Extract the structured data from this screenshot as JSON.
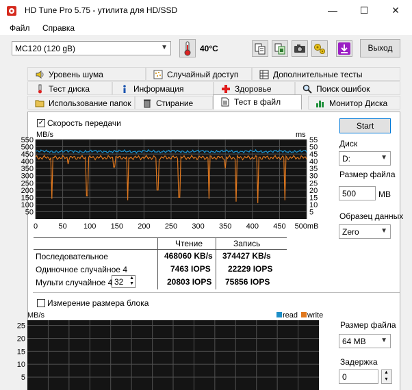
{
  "window": {
    "title": "HD Tune Pro 5.75 - утилита для HD/SSD",
    "minimize": "—",
    "maximize": "☐",
    "close": "✕"
  },
  "menu": {
    "file": "Файл",
    "help": "Справка"
  },
  "toolbar": {
    "drive": "MC120 (120 gB)",
    "temperature": "40°C",
    "exit_label": "Выход"
  },
  "tabs": {
    "row1": [
      "Уровень шума",
      "Случайный доступ",
      "Дополнительные тесты"
    ],
    "row2": [
      "Тест диска",
      "Информация",
      "Здоровье",
      "Поиск ошибок"
    ],
    "row3": [
      "Использование папок",
      "Стирание",
      "Тест в файл",
      "Монитор Диска"
    ]
  },
  "transfer": {
    "checkbox_label": "Скорость передачи",
    "left_unit": "MB/s",
    "right_unit": "ms",
    "x_unit_suffix": "mB"
  },
  "results": {
    "col_read": "Чтение",
    "col_write": "Запись",
    "rows": [
      {
        "label": "Последовательное",
        "read": "468060 KB/s",
        "write": "374427 KB/s"
      },
      {
        "label": "Одиночное случайное 4",
        "read": "7463 IOPS",
        "write": "22229 IOPS"
      },
      {
        "label": "Мульти случайное 4",
        "read": "20803 IOPS",
        "write": "75856 IOPS"
      }
    ],
    "queue_depth": "32"
  },
  "right_panel": {
    "start_label": "Start",
    "disk_label": "Диск",
    "disk_value": "D:",
    "file_size_label": "Размер файла",
    "file_size_value": "500",
    "file_size_unit": "MB",
    "pattern_label": "Образец данных",
    "pattern_value": "Zero"
  },
  "block": {
    "checkbox_label": "Измерение размера блока",
    "unit": "MB/s",
    "legend_read": "read",
    "legend_write": "write",
    "file_size_label": "Размер файла",
    "file_size_value": "64 MB",
    "delay_label": "Задержка",
    "delay_value": "0"
  },
  "colors": {
    "read": "#1e8fc8",
    "write": "#e0781e",
    "grid": "#505050",
    "plot_bg": "#141414"
  },
  "chart_data": [
    {
      "type": "line",
      "xlabel": "",
      "ylabel": "MB/s",
      "xlim": [
        0,
        500
      ],
      "ylim": [
        0,
        550
      ],
      "y2lim": [
        0,
        55
      ],
      "x_ticks": [
        0,
        50,
        100,
        150,
        200,
        250,
        300,
        350,
        400,
        450,
        500
      ],
      "y_ticks": [
        50,
        100,
        150,
        200,
        250,
        300,
        350,
        400,
        450,
        500,
        550
      ],
      "y2_ticks": [
        5,
        10,
        15,
        20,
        25,
        30,
        35,
        40,
        45,
        50,
        55
      ],
      "grid": true,
      "series": [
        {
          "name": "read",
          "baseline": 468,
          "values": [
            460,
            470,
            455,
            465,
            480,
            470,
            462,
            475,
            468,
            472,
            470,
            466,
            470,
            478,
            465,
            470
          ]
        },
        {
          "name": "write",
          "baseline": 425,
          "drops": [
            {
              "x": 30,
              "y": 140
            },
            {
              "x": 60,
              "y": 380
            },
            {
              "x": 95,
              "y": 160
            },
            {
              "x": 145,
              "y": 360
            },
            {
              "x": 170,
              "y": 130
            },
            {
              "x": 225,
              "y": 200
            },
            {
              "x": 265,
              "y": 150
            },
            {
              "x": 320,
              "y": 140
            },
            {
              "x": 350,
              "y": 350
            },
            {
              "x": 370,
              "y": 120
            },
            {
              "x": 410,
              "y": 110
            },
            {
              "x": 460,
              "y": 130
            }
          ]
        }
      ]
    },
    {
      "type": "line",
      "ylabel": "MB/s",
      "ylim": [
        0,
        27
      ],
      "y_ticks": [
        5,
        10,
        15,
        20,
        25
      ],
      "grid": true,
      "series": []
    }
  ]
}
